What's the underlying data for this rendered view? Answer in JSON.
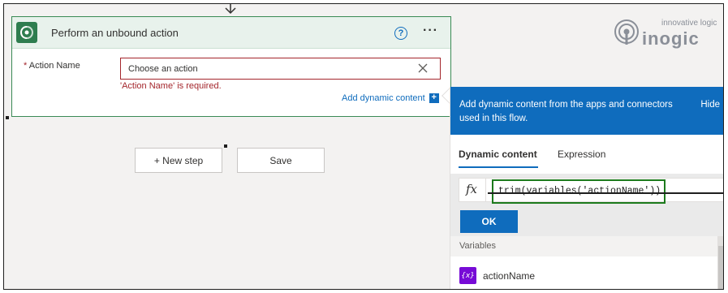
{
  "logo": {
    "tagline": "innovative logic",
    "name": "inogic"
  },
  "card": {
    "title": "Perform an unbound action",
    "help_icon": "help-circle-icon",
    "more_icon": "ellipsis-icon",
    "app_icon": "dataverse-icon",
    "field_label": "Action Name",
    "required_marker": "*",
    "action_placeholder": "Choose an action",
    "error_message": "'Action Name' is required.",
    "add_dynamic_label": "Add dynamic content",
    "add_dynamic_icon": "+"
  },
  "buttons": {
    "new_step": "+ New step",
    "save": "Save"
  },
  "panel": {
    "header_text": "Add dynamic content from the apps and connectors used in this flow.",
    "hide_label": "Hide",
    "tabs": [
      {
        "label": "Dynamic content",
        "active": true
      },
      {
        "label": "Expression",
        "active": false
      }
    ],
    "fx_label": "fx",
    "expression": "trim(variables('actionName'))",
    "ok_label": "OK",
    "section_title": "Variables",
    "variables": [
      {
        "icon_text": "{x}",
        "name": "actionName"
      }
    ]
  },
  "colors": {
    "accent": "#0f6cbd",
    "card_border": "#3a8a55",
    "error": "#a4262c",
    "expression_highlight": "#1c7a1c",
    "variable_icon": "#770bd6"
  }
}
